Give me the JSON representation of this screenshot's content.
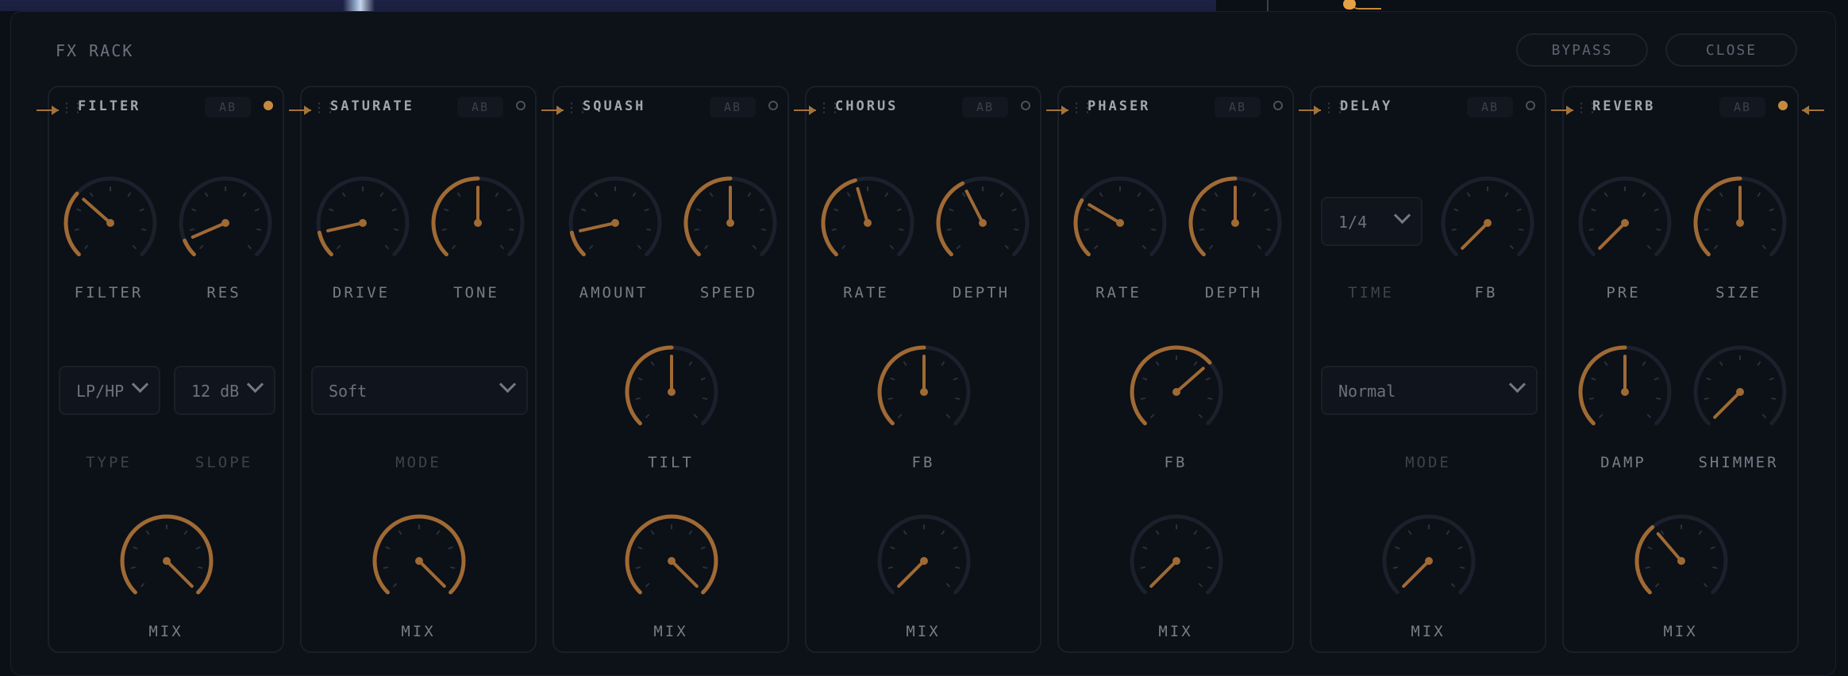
{
  "rack": {
    "title": "FX RACK",
    "bypass_label": "BYPASS",
    "close_label": "CLOSE"
  },
  "colors": {
    "accent": "#a06a34",
    "knob_track": "#1b212c",
    "led_on": "#c68a3e"
  },
  "modules": [
    {
      "name": "FILTER",
      "ab": "AB",
      "active": true,
      "knobs": [
        {
          "label": "FILTER",
          "value": 0.32
        },
        {
          "label": "RES",
          "value": 0.08
        },
        {
          "label": "MIX",
          "value": 1.0
        }
      ],
      "selects": [
        {
          "value": "LP/HP",
          "label": "TYPE"
        },
        {
          "value": "12 dB",
          "label": "SLOPE"
        }
      ]
    },
    {
      "name": "SATURATE",
      "ab": "AB",
      "active": false,
      "knobs": [
        {
          "label": "DRIVE",
          "value": 0.12
        },
        {
          "label": "TONE",
          "value": 0.5
        },
        {
          "label": "MIX",
          "value": 1.0
        }
      ],
      "selects": [
        {
          "value": "Soft",
          "label": "MODE"
        }
      ]
    },
    {
      "name": "SQUASH",
      "ab": "AB",
      "active": false,
      "knobs": [
        {
          "label": "AMOUNT",
          "value": 0.12
        },
        {
          "label": "SPEED",
          "value": 0.5
        },
        {
          "label": "TILT",
          "value": 0.5
        },
        {
          "label": "MIX",
          "value": 1.0
        }
      ]
    },
    {
      "name": "CHORUS",
      "ab": "AB",
      "active": false,
      "knobs": [
        {
          "label": "RATE",
          "value": 0.44
        },
        {
          "label": "DEPTH",
          "value": 0.4
        },
        {
          "label": "FB",
          "value": 0.5
        },
        {
          "label": "MIX",
          "value": 0.0
        }
      ]
    },
    {
      "name": "PHASER",
      "ab": "AB",
      "active": false,
      "knobs": [
        {
          "label": "RATE",
          "value": 0.28
        },
        {
          "label": "DEPTH",
          "value": 0.5
        },
        {
          "label": "FB",
          "value": 0.68
        },
        {
          "label": "MIX",
          "value": 0.0
        }
      ]
    },
    {
      "name": "DELAY",
      "ab": "AB",
      "active": false,
      "knobs": [
        {
          "label": "FB",
          "value": 0.0
        },
        {
          "label": "MIX",
          "value": 0.0
        }
      ],
      "selects": [
        {
          "value": "1/4",
          "label": "TIME"
        },
        {
          "value": "Normal",
          "label": "MODE"
        }
      ]
    },
    {
      "name": "REVERB",
      "ab": "AB",
      "active": true,
      "knobs": [
        {
          "label": "PRE",
          "value": 0.0
        },
        {
          "label": "SIZE",
          "value": 0.5
        },
        {
          "label": "DAMP",
          "value": 0.5
        },
        {
          "label": "SHIMMER",
          "value": 0.0
        },
        {
          "label": "MIX",
          "value": 0.35
        }
      ]
    }
  ]
}
